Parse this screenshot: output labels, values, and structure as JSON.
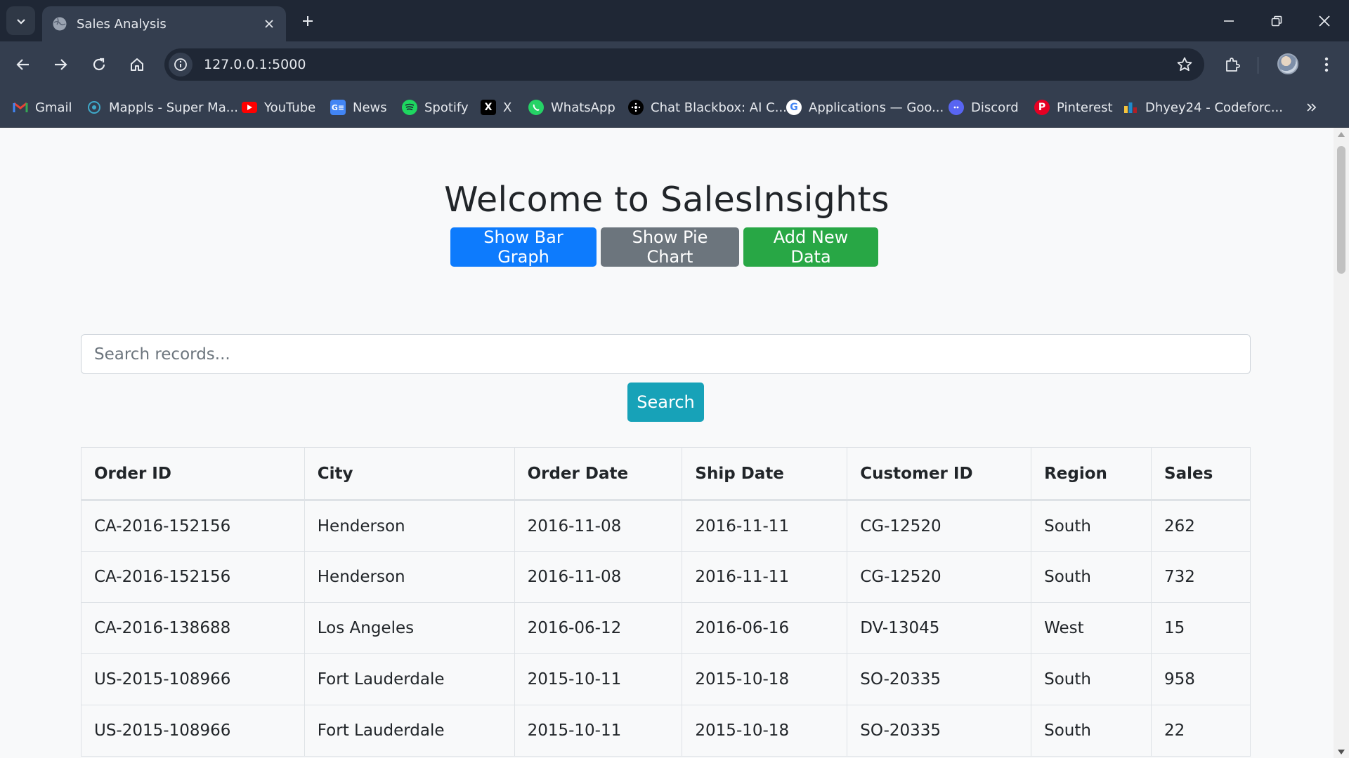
{
  "browser": {
    "tab_title": "Sales Analysis",
    "url": "127.0.0.1:5000",
    "bookmarks": [
      {
        "label": "Gmail",
        "icon": "gmail-icon"
      },
      {
        "label": "Mappls - Super Ma...",
        "icon": "mappls-icon"
      },
      {
        "label": "YouTube",
        "icon": "youtube-icon"
      },
      {
        "label": "News",
        "icon": "news-icon"
      },
      {
        "label": "Spotify",
        "icon": "spotify-icon"
      },
      {
        "label": "X",
        "icon": "x-icon"
      },
      {
        "label": "WhatsApp",
        "icon": "whatsapp-icon"
      },
      {
        "label": "Chat Blackbox: AI C...",
        "icon": "blackbox-icon"
      },
      {
        "label": "Applications — Goo...",
        "icon": "google-icon"
      },
      {
        "label": "Discord",
        "icon": "discord-icon"
      },
      {
        "label": "Pinterest",
        "icon": "pinterest-icon"
      },
      {
        "label": "Dhyey24 - Codeforc...",
        "icon": "codeforces-icon"
      }
    ]
  },
  "page": {
    "heading": "Welcome to SalesInsights",
    "buttons": {
      "bar": "Show Bar Graph",
      "pie": "Show Pie Chart",
      "add": "Add New Data"
    },
    "search": {
      "placeholder": "Search records...",
      "button": "Search"
    },
    "table": {
      "headers": [
        "Order ID",
        "City",
        "Order Date",
        "Ship Date",
        "Customer ID",
        "Region",
        "Sales"
      ],
      "rows": [
        [
          "CA-2016-152156",
          "Henderson",
          "2016-11-08",
          "2016-11-11",
          "CG-12520",
          "South",
          "262"
        ],
        [
          "CA-2016-152156",
          "Henderson",
          "2016-11-08",
          "2016-11-11",
          "CG-12520",
          "South",
          "732"
        ],
        [
          "CA-2016-138688",
          "Los Angeles",
          "2016-06-12",
          "2016-06-16",
          "DV-13045",
          "West",
          "15"
        ],
        [
          "US-2015-108966",
          "Fort Lauderdale",
          "2015-10-11",
          "2015-10-18",
          "SO-20335",
          "South",
          "958"
        ],
        [
          "US-2015-108966",
          "Fort Lauderdale",
          "2015-10-11",
          "2015-10-18",
          "SO-20335",
          "South",
          "22"
        ]
      ]
    }
  },
  "colors": {
    "primary": "#0d7bfd",
    "secondary": "#6c757d",
    "success": "#28a745",
    "info": "#17a2b8"
  }
}
